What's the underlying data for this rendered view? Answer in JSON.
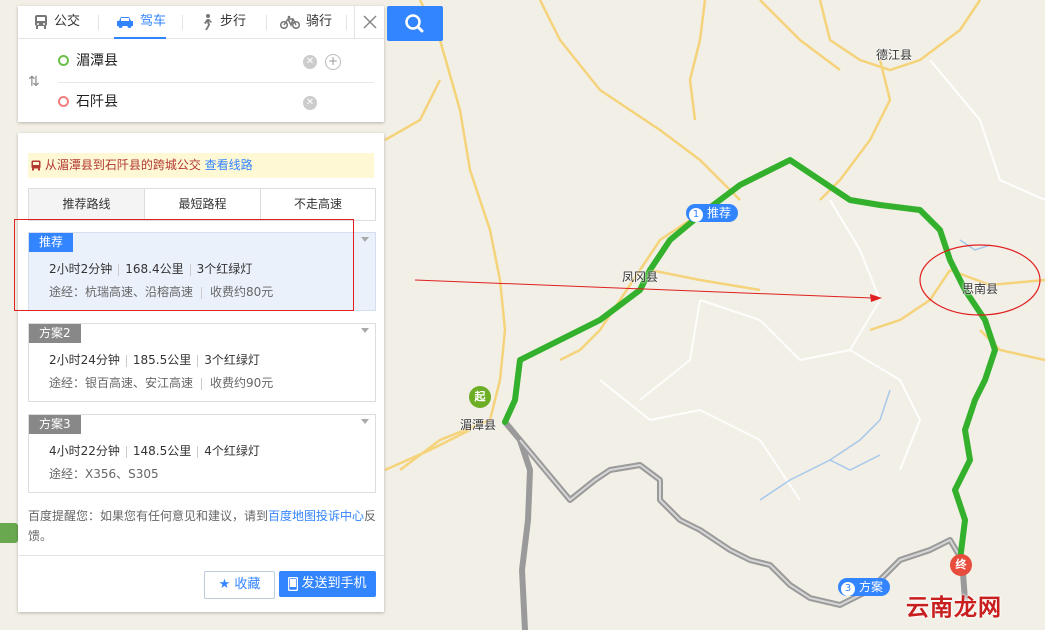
{
  "modes": [
    {
      "label": "公交",
      "icon": "bus-icon"
    },
    {
      "label": "驾车",
      "icon": "car-icon",
      "active": true
    },
    {
      "label": "步行",
      "icon": "walk-icon"
    },
    {
      "label": "骑行",
      "icon": "bike-icon"
    }
  ],
  "origin": "湄潭县",
  "destination": "石阡县",
  "notice": {
    "text": "从湄潭县到石阡县的跨城公交",
    "link": "查看线路"
  },
  "tabs": [
    "推荐路线",
    "最短路程",
    "不走高速"
  ],
  "routes": [
    {
      "tag": "推荐",
      "time": "2小时2分钟",
      "distance": "168.4公里",
      "lights": "3个红绿灯",
      "via": "途经：杭瑞高速、沿榕高速",
      "toll": "收费约80元",
      "tag_color": "#3385ff"
    },
    {
      "tag": "方案2",
      "time": "2小时24分钟",
      "distance": "185.5公里",
      "lights": "3个红绿灯",
      "via": "途经：银百高速、安江高速",
      "toll": "收费约90元",
      "tag_color": "#888888"
    },
    {
      "tag": "方案3",
      "time": "4小时22分钟",
      "distance": "148.5公里",
      "lights": "4个红绿灯",
      "via": "途经：X356、S305",
      "toll": "",
      "tag_color": "#888888"
    }
  ],
  "feedback": {
    "prefix": "百度提醒您：如果您有任何意见和建议，请到",
    "link": "百度地图投诉中心",
    "suffix": "反馈。"
  },
  "buttons": {
    "favorite": "收藏",
    "send": "发送到手机"
  },
  "map": {
    "labels": {
      "dejiang": "德江县",
      "fenggang": "凤冈县",
      "meitan": "湄潭县",
      "sinan": "思南县"
    },
    "badges": {
      "rec_num": "1",
      "rec": "推荐",
      "plan3_num": "3",
      "plan3": "方案"
    },
    "pins": {
      "start": "起",
      "end": "终"
    },
    "watermark": "云南龙网"
  },
  "colors": {
    "accent": "#3385ff",
    "route_main": "#35b22f",
    "route_alt": "#a6a6a6",
    "annotation": "#e02020"
  }
}
